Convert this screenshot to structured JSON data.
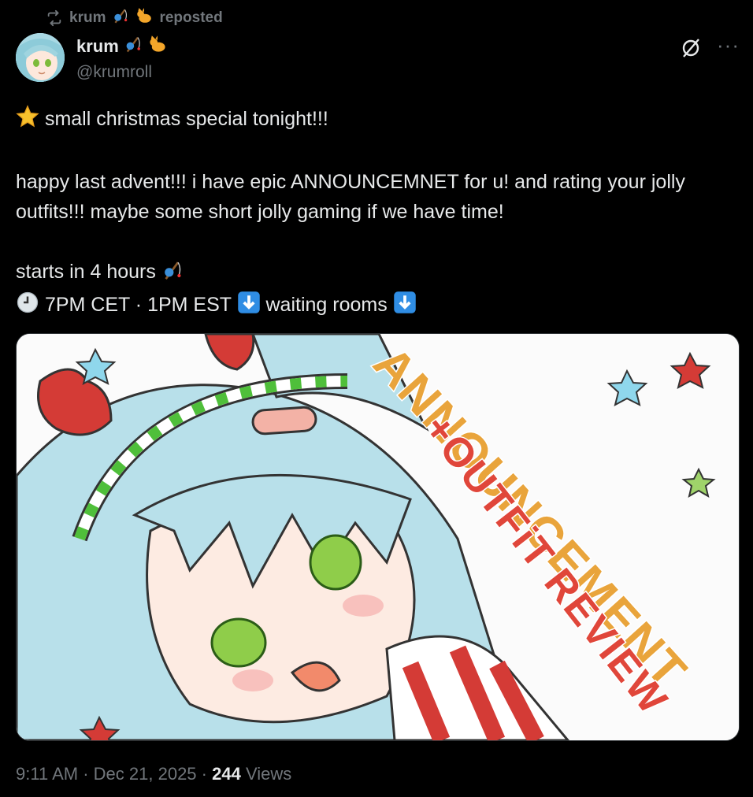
{
  "repost": {
    "name": "krum",
    "label": "reposted",
    "icon": "repost-icon"
  },
  "author": {
    "name": "krum",
    "handle": "@krumroll",
    "badges": [
      "fishing-pole-emoji",
      "cat-emoji"
    ]
  },
  "post": {
    "line1": "small christmas special tonight!!!",
    "line2": "happy last advent!!! i have epic ANNOUNCEMNET for u! and rating your jolly outfits!!! maybe some short jolly gaming if we have time!",
    "line3": "starts in 4 hours",
    "line4a": "7PM CET · 1PM EST",
    "line4b": "waiting rooms"
  },
  "media": {
    "title_line1": "ANNOUNCEMENT",
    "title_line2": "+OUTFiT REVIEW"
  },
  "meta": {
    "time": "9:11 AM",
    "sep1": "·",
    "date": "Dec 21, 2025",
    "sep2": "·",
    "views_count": "244",
    "views_label": "Views"
  },
  "colors": {
    "background": "#000000",
    "text": "#e7e9ea",
    "muted": "#71767b"
  }
}
